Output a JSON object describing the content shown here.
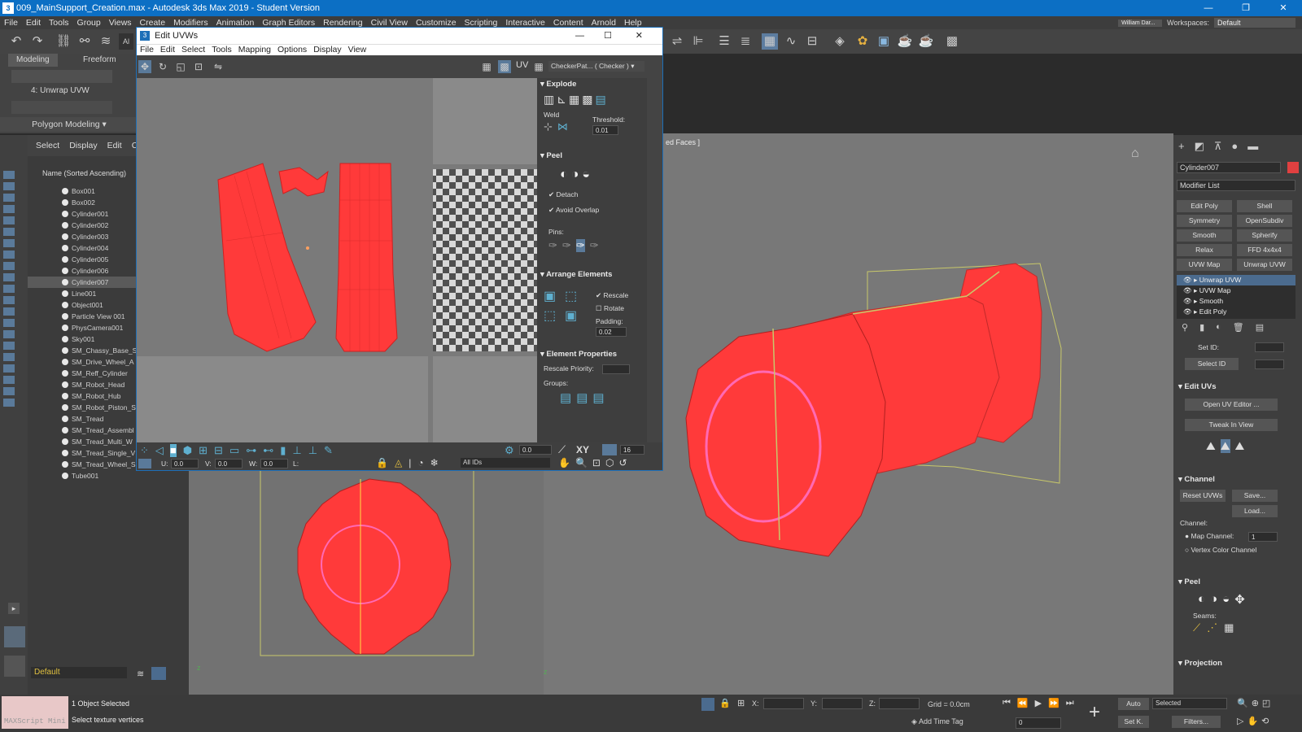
{
  "app": {
    "title": "009_MainSupport_Creation.max - Autodesk 3ds Max 2019 - Student Version",
    "menus": [
      "File",
      "Edit",
      "Tools",
      "Group",
      "Views",
      "Create",
      "Modifiers",
      "Animation",
      "Graph Editors",
      "Rendering",
      "Civil View",
      "Customize",
      "Scripting",
      "Interactive",
      "Content",
      "Arnold",
      "Help"
    ],
    "user": "William Dar...",
    "workspaces_label": "Workspaces:",
    "workspace": "Default",
    "accent": "#0c6fc4",
    "mesh_color": "#ff3333"
  },
  "ribbon": {
    "tabs": [
      "Modeling",
      "Freeform"
    ],
    "sub_label": "4: Unwrap UVW",
    "panel": "Polygon Modeling"
  },
  "explorer": {
    "menus": [
      "Select",
      "Display",
      "Edit",
      "Cu"
    ],
    "header": "Name (Sorted Ascending)",
    "items": [
      "Box001",
      "Box002",
      "Cylinder001",
      "Cylinder002",
      "Cylinder003",
      "Cylinder004",
      "Cylinder005",
      "Cylinder006",
      "Cylinder007",
      "Line001",
      "Object001",
      "Particle View 001",
      "PhysCamera001",
      "Sky001",
      "SM_Chassy_Base_S",
      "SM_Drive_Wheel_A",
      "SM_Reff_Cylinder",
      "SM_Robot_Head",
      "SM_Robot_Hub",
      "SM_Robot_Piston_S",
      "SM_Tread",
      "SM_Tread_Assembl",
      "SM_Tread_Multi_W",
      "SM_Tread_Single_V",
      "SM_Tread_Wheel_S",
      "Tube001"
    ],
    "selected": "Cylinder007",
    "layer": "Default"
  },
  "uv_editor": {
    "title": "Edit UVWs",
    "menus": [
      "File",
      "Edit",
      "Select",
      "Tools",
      "Mapping",
      "Options",
      "Display",
      "View"
    ],
    "uv_label": "UV",
    "checker": "CheckerPat... ( Checker )",
    "explode": {
      "header": "Explode",
      "weld": "Weld",
      "threshold_label": "Threshold:",
      "threshold": "0.01"
    },
    "peel": {
      "header": "Peel",
      "detach": "Detach",
      "avoid_overlap": "Avoid Overlap",
      "pins": "Pins:"
    },
    "arrange": {
      "header": "Arrange Elements",
      "rescale": "Rescale",
      "rotate": "Rotate",
      "padding_label": "Padding:",
      "padding": "0.02"
    },
    "element_props": {
      "header": "Element Properties",
      "rescale_priority": "Rescale Priority:",
      "groups": "Groups:"
    },
    "bottom": {
      "angle": "0.0",
      "xy": "XY",
      "grid": "16",
      "u_label": "U:",
      "u": "0.0",
      "v_label": "V:",
      "v": "0.0",
      "w_label": "W:",
      "w": "0.0",
      "l_label": "L:",
      "ids": "All IDs"
    }
  },
  "viewport_label": "ed Faces ]",
  "command_panel": {
    "object_name": "Cylinder007",
    "modifier_list": "Modifier List",
    "buttons": [
      "Edit Poly",
      "Shell",
      "Symmetry",
      "OpenSubdiv",
      "Smooth",
      "Spherify",
      "Relax",
      "FFD 4x4x4",
      "UVW Map",
      "Unwrap UVW"
    ],
    "stack": [
      "Unwrap UVW",
      "UVW Map",
      "Smooth",
      "Edit Poly"
    ],
    "set_id": "Set ID:",
    "select_id": "Select ID",
    "edit_uvs": {
      "header": "Edit UVs",
      "open": "Open UV Editor ...",
      "tweak": "Tweak In View"
    },
    "channel": {
      "header": "Channel",
      "reset": "Reset UVWs",
      "save": "Save...",
      "load": "Load...",
      "label": "Channel:",
      "map_channel": "Map Channel:",
      "map_value": "1",
      "vertex_color": "Vertex Color Channel"
    },
    "peel": {
      "header": "Peel",
      "seams": "Seams:"
    },
    "projection": {
      "header": "Projection"
    }
  },
  "status": {
    "maxscript": "MAXScript Mini",
    "selected": "1 Object Selected",
    "prompt": "Select texture vertices",
    "x_label": "X:",
    "y_label": "Y:",
    "z_label": "Z:",
    "grid": "Grid = 0.0cm",
    "add_time_tag": "Add Time Tag",
    "auto": "Auto",
    "set_k": "Set K.",
    "selected_dd": "Selected",
    "filters": "Filters...",
    "frame": "0"
  }
}
